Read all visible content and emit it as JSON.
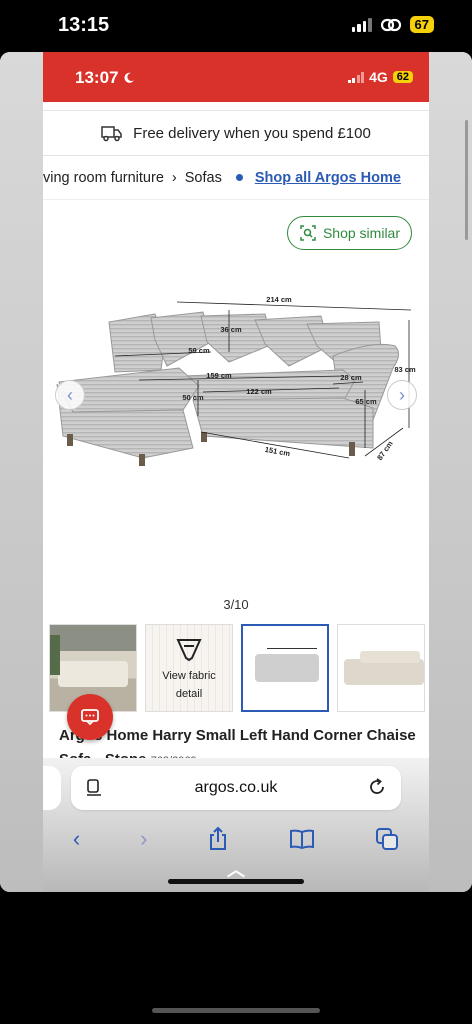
{
  "outer_status": {
    "time": "13:15",
    "battery": "67"
  },
  "inner_status": {
    "time": "13:07",
    "network": "4G",
    "battery": "62"
  },
  "delivery_banner": {
    "text": "Free delivery when you spend £100"
  },
  "breadcrumb": {
    "item1": "ving room furniture",
    "item2": "Sofas",
    "link": "Shop all Argos Home"
  },
  "gallery": {
    "shop_similar": "Shop similar",
    "pager": "3/10",
    "dimensions": {
      "width": "214 cm",
      "back_height": "36 cm",
      "seat_depth": "59 cm",
      "chaise_seat": "159 cm",
      "seat_width": "122 cm",
      "total_height": "83 cm",
      "arm_width": "28 cm",
      "seat_height": "50 cm",
      "arm_height": "65 cm",
      "depth": "87 cm",
      "chaise_length": "151 cm"
    }
  },
  "thumbnails": {
    "fabric_line1": "View fabric",
    "fabric_line2": "detail"
  },
  "product": {
    "title": "Argos Home Harry Small Left Hand Corner Chaise Sofa - Stone",
    "sku": "763/2969"
  },
  "browser": {
    "url": "argos.co.uk"
  },
  "colors": {
    "argos_red": "#d9322a",
    "link_blue": "#2b5bb5",
    "shop_green": "#2f8a3e"
  },
  "icons": [
    "wifi-link-icon",
    "van-icon",
    "visual-search-icon",
    "chevron-left-icon",
    "chevron-right-icon",
    "chat-icon",
    "reader-icon",
    "reload-icon",
    "share-icon",
    "bookmarks-icon",
    "tabs-icon"
  ]
}
